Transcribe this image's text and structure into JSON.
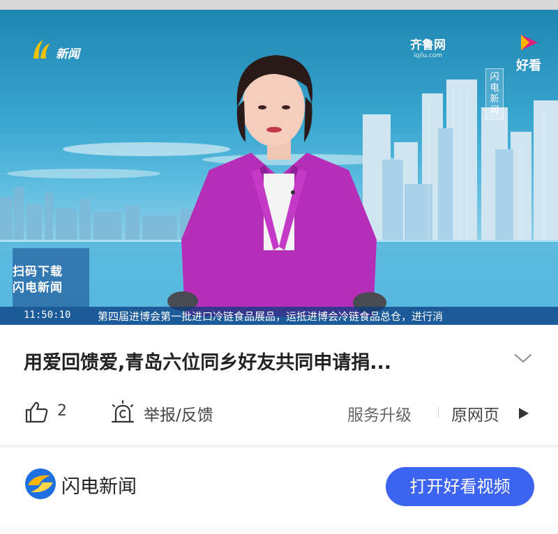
{
  "video": {
    "channel_logo_text": "新闻",
    "qilu_logo_text": "齐鲁网",
    "qilu_logo_sub": "iqilu.com",
    "haokan_logo_text": "好看",
    "vertical_tag": "闪电新闻",
    "qr_line1": "扫码下载",
    "qr_line2": "闪电新闻",
    "timestamp": "11:50:10",
    "ticker_text": "第四届进博会第一批进口冷链食品展品，运抵进博会冷链食品总仓，进行消"
  },
  "article": {
    "title": "用爱回馈爱,青岛六位同乡好友共同申请捐..."
  },
  "actions": {
    "like_count": "2",
    "report_label": "举报/反馈",
    "service_label": "服务升级",
    "original_label": "原网页"
  },
  "footer": {
    "app_name": "闪电新闻",
    "open_button": "打开好看视频"
  },
  "colors": {
    "primary_button": "#3c64f0",
    "anchor_jacket": "#b62db8",
    "ticker_bg": "#0a3c82"
  }
}
